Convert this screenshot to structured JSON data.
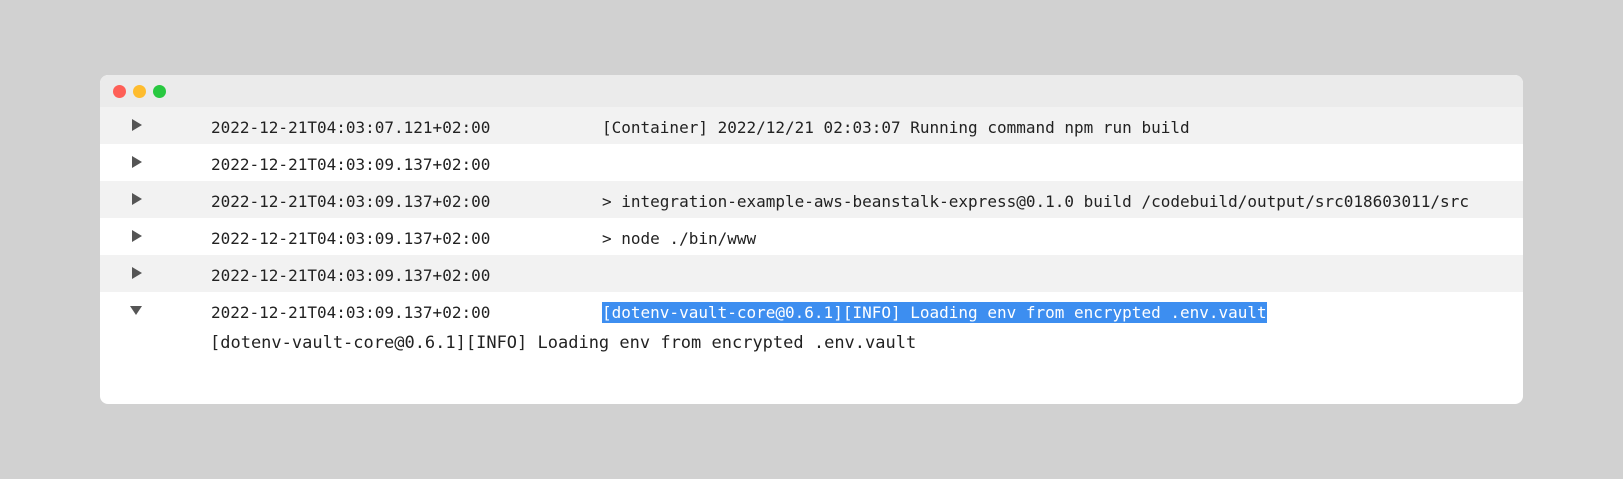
{
  "window": {
    "controls": [
      "close",
      "minimize",
      "zoom"
    ]
  },
  "colors": {
    "background": "#d1d1d1",
    "row_alt": "#f2f2f2",
    "selection": "#3d8ef0",
    "toggle": "#555555"
  },
  "rows": [
    {
      "timestamp": "2022-12-21T04:03:07.121+02:00",
      "message": "[Container] 2022/12/21 02:03:07 Running command npm run build",
      "expanded": false,
      "icon": "triangle-right-icon"
    },
    {
      "timestamp": "2022-12-21T04:03:09.137+02:00",
      "message": "",
      "expanded": false,
      "icon": "triangle-right-icon"
    },
    {
      "timestamp": "2022-12-21T04:03:09.137+02:00",
      "message": "> integration-example-aws-beanstalk-express@0.1.0 build /codebuild/output/src018603011/src",
      "expanded": false,
      "icon": "triangle-right-icon"
    },
    {
      "timestamp": "2022-12-21T04:03:09.137+02:00",
      "message": "> node ./bin/www",
      "expanded": false,
      "icon": "triangle-right-icon"
    },
    {
      "timestamp": "2022-12-21T04:03:09.137+02:00",
      "message": "",
      "expanded": false,
      "icon": "triangle-right-icon"
    },
    {
      "timestamp": "2022-12-21T04:03:09.137+02:00",
      "message": "[dotenv-vault-core@0.6.1][INFO] Loading env from encrypted .env.vault",
      "expanded": true,
      "selected": true,
      "icon": "triangle-down-icon"
    }
  ],
  "expanded_detail": "[dotenv-vault-core@0.6.1][INFO] Loading env from encrypted .env.vault"
}
